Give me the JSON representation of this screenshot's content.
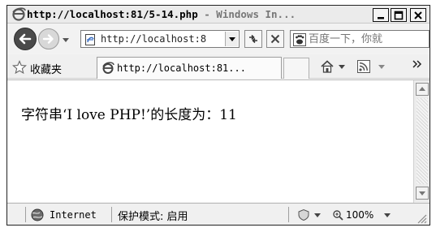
{
  "window": {
    "title_main": "http://localhost:81/5-14.php",
    "title_app": " - Windows In...",
    "buttons": {
      "minimize": "minimize",
      "maximize": "maximize",
      "close": "close"
    }
  },
  "nav": {
    "address": "http://localhost:8",
    "search_placeholder": "百度一下，你就"
  },
  "favorites": {
    "label": "收藏夹",
    "tab_title": "http://localhost:81..."
  },
  "page": {
    "message": "字符串‘I love PHP!’的长度为：11"
  },
  "status": {
    "zone": "Internet",
    "mode": "保护模式: 启用",
    "zoom": "100%"
  },
  "colors": {
    "accent": "#1a4fa0",
    "titlebar": "#ebebeb"
  },
  "icons": [
    "ie-logo-icon",
    "back-arrow-icon",
    "forward-arrow-icon",
    "chevron-down-icon",
    "page-icon",
    "refresh-icon",
    "stop-icon",
    "baidu-icon",
    "star-icon",
    "home-icon",
    "rss-icon",
    "globe-icon",
    "zoom-icon"
  ]
}
